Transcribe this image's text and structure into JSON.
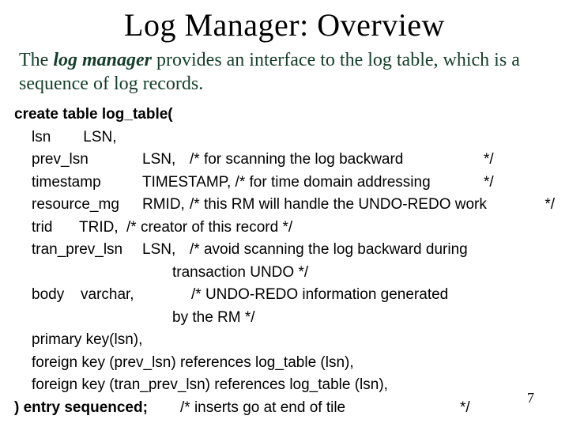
{
  "title": "Log Manager: Overview",
  "intro_pre": "The ",
  "intro_emph": "log manager",
  "intro_post": " provides an interface to the log table, which is a sequence of log records.",
  "code": {
    "l01": "create table log_table(",
    "l02a": "lsn",
    "l02b": "LSN,",
    "l03a": "prev_lsn",
    "l03b": "LSN,",
    "l03c": "/* for scanning the log backward",
    "l03d": "*/",
    "l04a": "timestamp",
    "l04b": "TIMESTAMP,  /* for time domain addressing",
    "l04c": "*/",
    "l05a": "resource_mg",
    "l05b": "RMID,",
    "l05c": "/* this RM will handle the UNDO-REDO work",
    "l05d": "*/",
    "l06a": "trid",
    "l06b": "TRID,",
    "l06c": "/* creator of this record   */",
    "l07a": "tran_prev_lsn",
    "l07b": "LSN,",
    "l07c": "/* avoid scanning the log backward during",
    "l07x": "transaction UNDO      */",
    "l08a": "body",
    "l08b": "varchar,",
    "l08c": "/* UNDO-REDO information generated",
    "l08x": "by the RM      */",
    "l09": "primary key(lsn),",
    "l10": "foreign key (prev_lsn)  references log_table (lsn),",
    "l11": "foreign key (tran_prev_lsn) references log_table (lsn),",
    "l12a": ") entry sequenced;",
    "l12b": "/* inserts go at end of tile",
    "l12c": "*/"
  },
  "pagenum": "7"
}
